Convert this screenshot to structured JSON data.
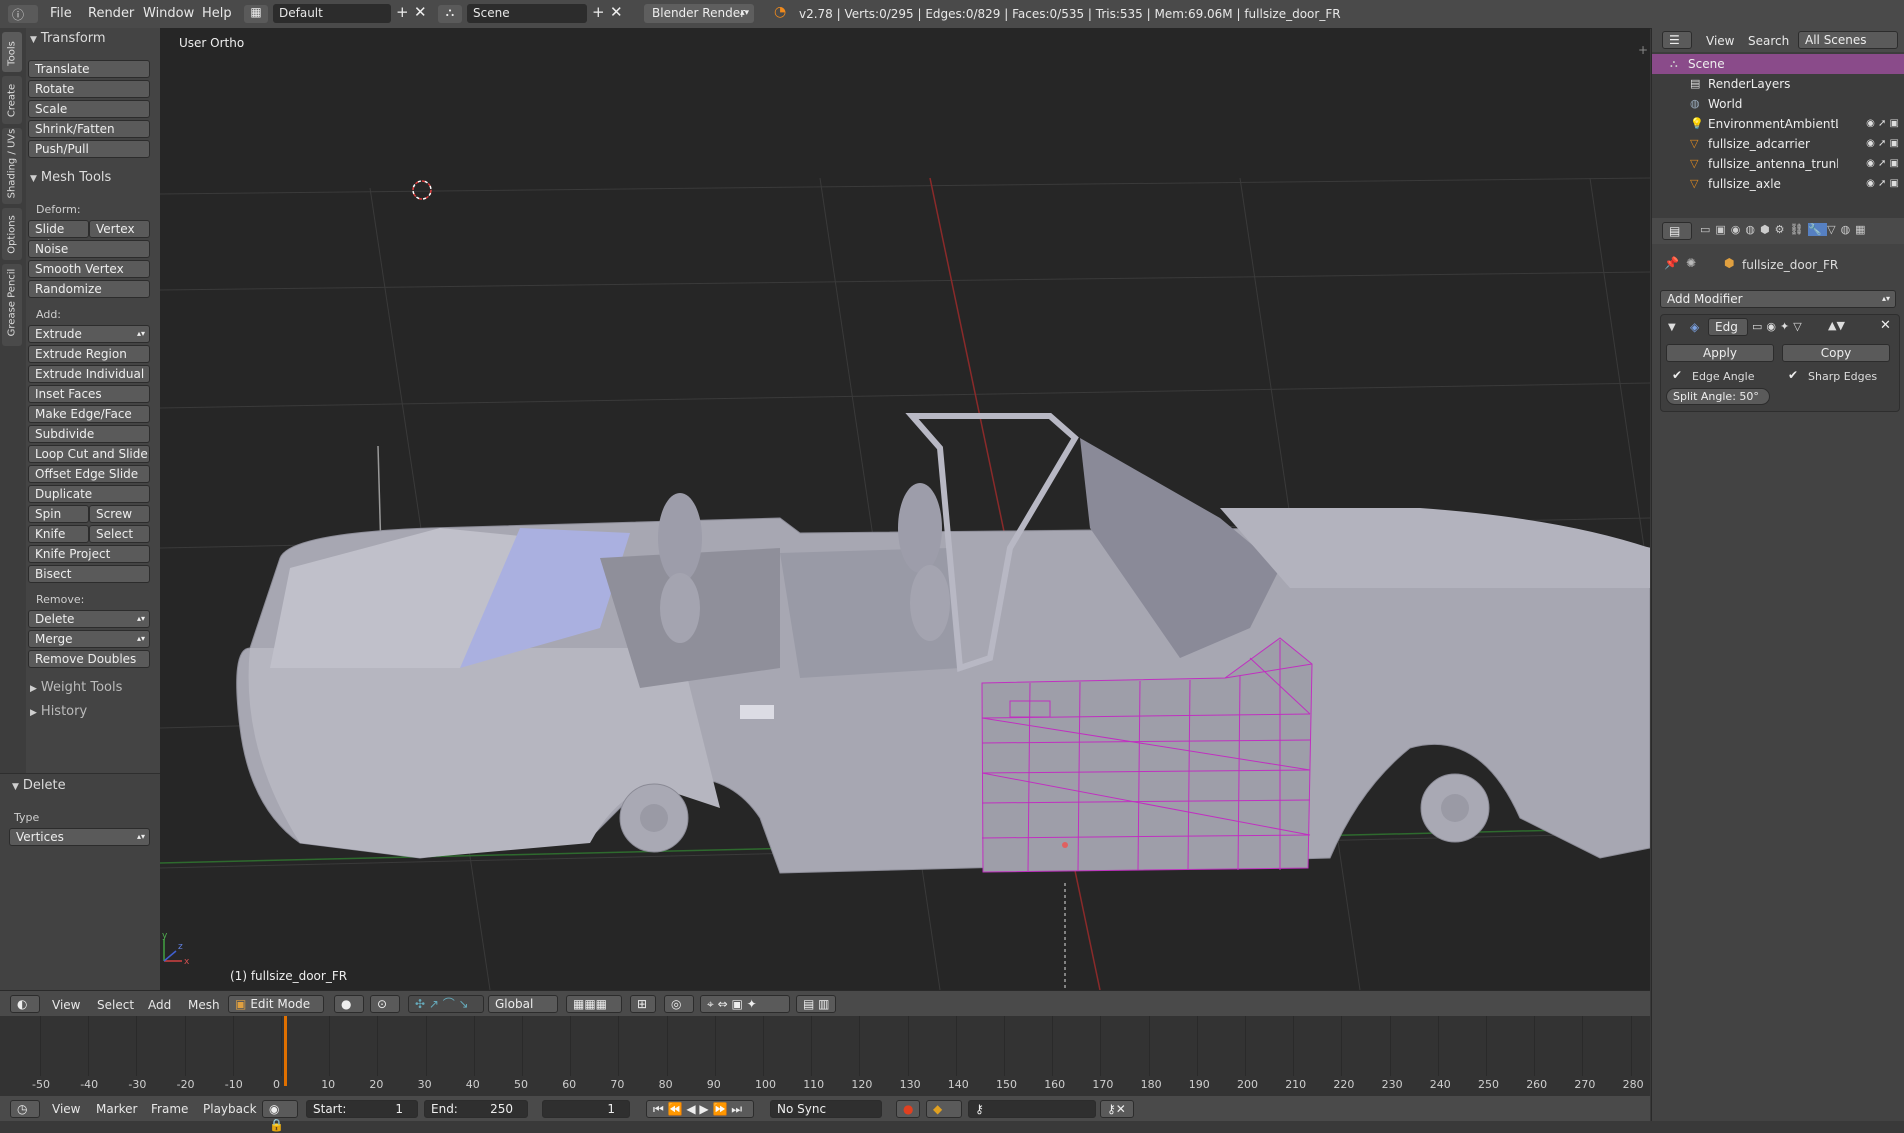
{
  "topbar": {
    "menus": [
      "File",
      "Render",
      "Window",
      "Help"
    ],
    "layout": "Default",
    "scene": "Scene",
    "engine": "Blender Render",
    "stats": "v2.78 | Verts:0/295 | Edges:0/829 | Faces:0/535 | Tris:535 | Mem:69.06M | fullsize_door_FR"
  },
  "tabs": [
    "Tools",
    "Create",
    "Shading / UVs",
    "Options",
    "Grease Pencil"
  ],
  "shelf": {
    "transform_title": "Transform",
    "transform": [
      "Translate",
      "Rotate",
      "Scale",
      "Shrink/Fatten",
      "Push/Pull"
    ],
    "mesh_tools_title": "Mesh Tools",
    "deform_label": "Deform:",
    "slide_edge": "Slide Edge",
    "vertex": "Vertex",
    "deform": [
      "Noise",
      "Smooth Vertex",
      "Randomize"
    ],
    "add_label": "Add:",
    "extrude": "Extrude",
    "add": [
      "Extrude Region",
      "Extrude Individual",
      "Inset Faces",
      "Make Edge/Face",
      "Subdivide",
      "Loop Cut and Slide",
      "Offset Edge Slide",
      "Duplicate"
    ],
    "spin": "Spin",
    "screw": "Screw",
    "knife": "Knife",
    "select": "Select",
    "knife_project": "Knife Project",
    "bisect": "Bisect",
    "remove_label": "Remove:",
    "delete": "Delete",
    "merge": "Merge",
    "remove_doubles": "Remove Doubles",
    "weight_tools": "Weight Tools",
    "history": "History",
    "op_title": "Delete",
    "op_type_label": "Type",
    "op_type_value": "Vertices"
  },
  "viewport": {
    "view_label": "User Ortho",
    "object_label": "(1) fullsize_door_FR",
    "axis_x": "x",
    "axis_y": "y",
    "axis_z": "z"
  },
  "view_header": {
    "menus": [
      "View",
      "Select",
      "Add",
      "Mesh"
    ],
    "mode": "Edit Mode",
    "orientation": "Global"
  },
  "timeline": {
    "ticks": [
      "-50",
      "-40",
      "-30",
      "-20",
      "-10",
      "0",
      "10",
      "20",
      "30",
      "40",
      "50",
      "60",
      "70",
      "80",
      "90",
      "100",
      "110",
      "120",
      "130",
      "140",
      "150",
      "160",
      "170",
      "180",
      "190",
      "200",
      "210",
      "220",
      "230",
      "240",
      "250",
      "260",
      "270",
      "280"
    ],
    "current_frame_value": 1,
    "menus": [
      "View",
      "Marker",
      "Frame",
      "Playback"
    ],
    "start": "Start:",
    "start_val": "1",
    "end": "End:",
    "end_val": "250",
    "frame": "1",
    "sync": "No Sync"
  },
  "outliner": {
    "menus": [
      "View",
      "Search"
    ],
    "filter": "All Scenes",
    "items": [
      {
        "name": "Scene",
        "level": 0,
        "selected": true,
        "icon": "scene-icon"
      },
      {
        "name": "RenderLayers",
        "level": 1,
        "selected": false,
        "icon": "renderlayers-icon"
      },
      {
        "name": "World",
        "level": 1,
        "selected": false,
        "icon": "world-icon"
      },
      {
        "name": "EnvironmentAmbientLi",
        "level": 1,
        "selected": false,
        "icon": "lamp-icon"
      },
      {
        "name": "fullsize_adcarrier",
        "level": 1,
        "selected": false,
        "icon": "mesh-object-icon"
      },
      {
        "name": "fullsize_antenna_trunk",
        "level": 1,
        "selected": false,
        "icon": "mesh-object-icon"
      },
      {
        "name": "fullsize_axle",
        "level": 1,
        "selected": false,
        "icon": "mesh-object-icon"
      }
    ]
  },
  "properties": {
    "object_name": "fullsize_door_FR",
    "add_modifier": "Add Modifier",
    "modifier_name": "Edg",
    "apply": "Apply",
    "copy": "Copy",
    "edge_angle": "Edge Angle",
    "sharp_edges": "Sharp Edges",
    "split_angle": "Split Angle: 50°"
  },
  "colors": {
    "selection": "#c030c0",
    "active_tab": "#5680c2",
    "playhead": "#e07000"
  }
}
